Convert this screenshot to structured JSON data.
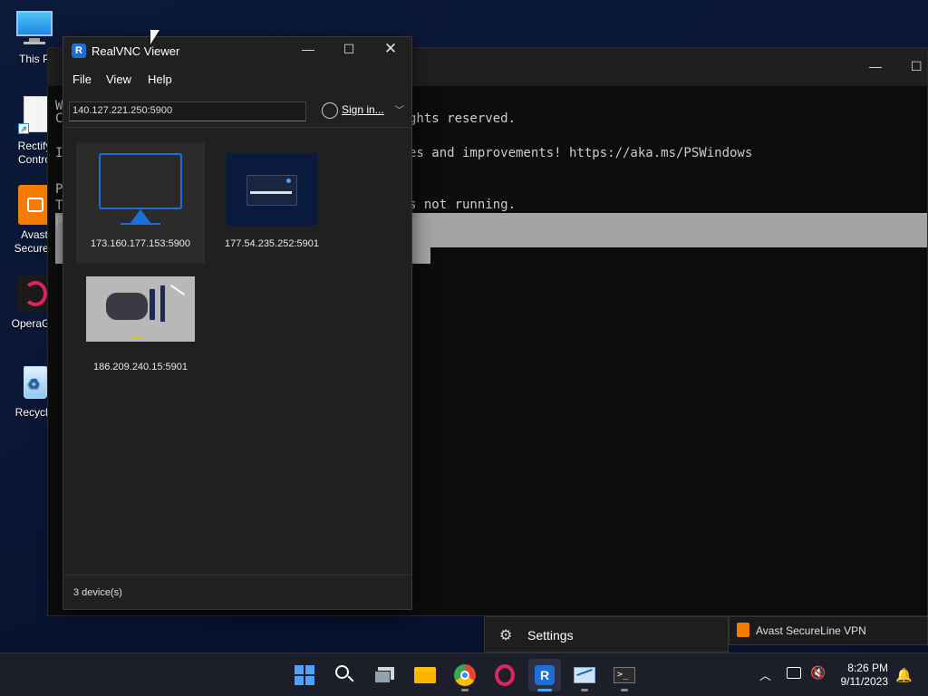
{
  "desktop": {
    "icons": [
      {
        "label": "This P"
      },
      {
        "label": "Rectify\nContro"
      },
      {
        "label": "Avast\nSecureL"
      },
      {
        "label": "OperaGX"
      },
      {
        "label": "Recycle"
      }
    ]
  },
  "terminal": {
    "lines": [
      "ghts reserved.",
      "es and improvements! https://aka.ms/PSWindows",
      "s not running."
    ],
    "left_fragments": [
      "W",
      "C",
      "I",
      "P",
      "T",
      "P"
    ]
  },
  "vnc": {
    "title": "RealVNC Viewer",
    "menu": [
      "File",
      "View",
      "Help"
    ],
    "address": "140.127.221.250:5900",
    "signin_label": "Sign in...",
    "devices": [
      {
        "label": "173.160.177.153:5900"
      },
      {
        "label": "177.54.235.252:5901"
      },
      {
        "label": "186.209.240.15:5901"
      }
    ],
    "status": "3 device(s)"
  },
  "popups": {
    "settings_label": "Settings",
    "avast_label": "Avast SecureLine VPN"
  },
  "taskbar": {
    "time": "8:26 PM",
    "date": "9/11/2023"
  },
  "colors": {
    "accent": "#4ca3ff",
    "vnc_blue": "#1b6fd8",
    "window_bg": "#202020"
  }
}
